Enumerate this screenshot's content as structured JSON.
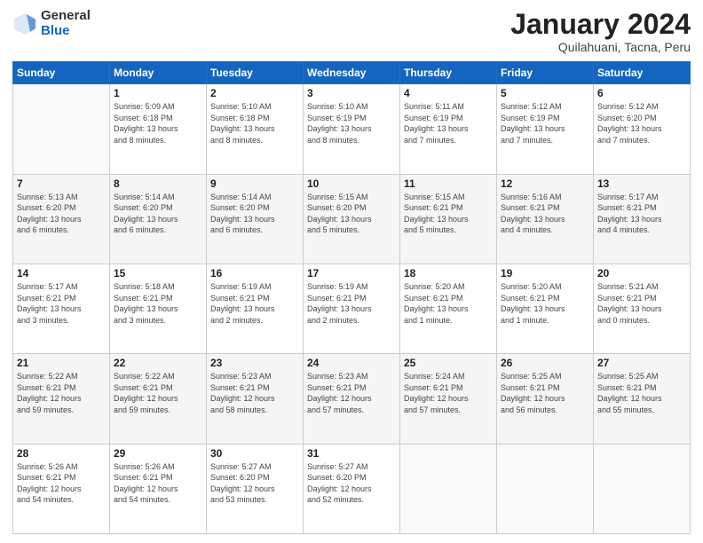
{
  "logo": {
    "general": "General",
    "blue": "Blue"
  },
  "header": {
    "title": "January 2024",
    "subtitle": "Quilahuani, Tacna, Peru"
  },
  "days_of_week": [
    "Sunday",
    "Monday",
    "Tuesday",
    "Wednesday",
    "Thursday",
    "Friday",
    "Saturday"
  ],
  "weeks": [
    [
      {
        "day": "",
        "info": ""
      },
      {
        "day": "1",
        "info": "Sunrise: 5:09 AM\nSunset: 6:18 PM\nDaylight: 13 hours\nand 8 minutes."
      },
      {
        "day": "2",
        "info": "Sunrise: 5:10 AM\nSunset: 6:18 PM\nDaylight: 13 hours\nand 8 minutes."
      },
      {
        "day": "3",
        "info": "Sunrise: 5:10 AM\nSunset: 6:19 PM\nDaylight: 13 hours\nand 8 minutes."
      },
      {
        "day": "4",
        "info": "Sunrise: 5:11 AM\nSunset: 6:19 PM\nDaylight: 13 hours\nand 7 minutes."
      },
      {
        "day": "5",
        "info": "Sunrise: 5:12 AM\nSunset: 6:19 PM\nDaylight: 13 hours\nand 7 minutes."
      },
      {
        "day": "6",
        "info": "Sunrise: 5:12 AM\nSunset: 6:20 PM\nDaylight: 13 hours\nand 7 minutes."
      }
    ],
    [
      {
        "day": "7",
        "info": "Sunrise: 5:13 AM\nSunset: 6:20 PM\nDaylight: 13 hours\nand 6 minutes."
      },
      {
        "day": "8",
        "info": "Sunrise: 5:14 AM\nSunset: 6:20 PM\nDaylight: 13 hours\nand 6 minutes."
      },
      {
        "day": "9",
        "info": "Sunrise: 5:14 AM\nSunset: 6:20 PM\nDaylight: 13 hours\nand 6 minutes."
      },
      {
        "day": "10",
        "info": "Sunrise: 5:15 AM\nSunset: 6:20 PM\nDaylight: 13 hours\nand 5 minutes."
      },
      {
        "day": "11",
        "info": "Sunrise: 5:15 AM\nSunset: 6:21 PM\nDaylight: 13 hours\nand 5 minutes."
      },
      {
        "day": "12",
        "info": "Sunrise: 5:16 AM\nSunset: 6:21 PM\nDaylight: 13 hours\nand 4 minutes."
      },
      {
        "day": "13",
        "info": "Sunrise: 5:17 AM\nSunset: 6:21 PM\nDaylight: 13 hours\nand 4 minutes."
      }
    ],
    [
      {
        "day": "14",
        "info": "Sunrise: 5:17 AM\nSunset: 6:21 PM\nDaylight: 13 hours\nand 3 minutes."
      },
      {
        "day": "15",
        "info": "Sunrise: 5:18 AM\nSunset: 6:21 PM\nDaylight: 13 hours\nand 3 minutes."
      },
      {
        "day": "16",
        "info": "Sunrise: 5:19 AM\nSunset: 6:21 PM\nDaylight: 13 hours\nand 2 minutes."
      },
      {
        "day": "17",
        "info": "Sunrise: 5:19 AM\nSunset: 6:21 PM\nDaylight: 13 hours\nand 2 minutes."
      },
      {
        "day": "18",
        "info": "Sunrise: 5:20 AM\nSunset: 6:21 PM\nDaylight: 13 hours\nand 1 minute."
      },
      {
        "day": "19",
        "info": "Sunrise: 5:20 AM\nSunset: 6:21 PM\nDaylight: 13 hours\nand 1 minute."
      },
      {
        "day": "20",
        "info": "Sunrise: 5:21 AM\nSunset: 6:21 PM\nDaylight: 13 hours\nand 0 minutes."
      }
    ],
    [
      {
        "day": "21",
        "info": "Sunrise: 5:22 AM\nSunset: 6:21 PM\nDaylight: 12 hours\nand 59 minutes."
      },
      {
        "day": "22",
        "info": "Sunrise: 5:22 AM\nSunset: 6:21 PM\nDaylight: 12 hours\nand 59 minutes."
      },
      {
        "day": "23",
        "info": "Sunrise: 5:23 AM\nSunset: 6:21 PM\nDaylight: 12 hours\nand 58 minutes."
      },
      {
        "day": "24",
        "info": "Sunrise: 5:23 AM\nSunset: 6:21 PM\nDaylight: 12 hours\nand 57 minutes."
      },
      {
        "day": "25",
        "info": "Sunrise: 5:24 AM\nSunset: 6:21 PM\nDaylight: 12 hours\nand 57 minutes."
      },
      {
        "day": "26",
        "info": "Sunrise: 5:25 AM\nSunset: 6:21 PM\nDaylight: 12 hours\nand 56 minutes."
      },
      {
        "day": "27",
        "info": "Sunrise: 5:25 AM\nSunset: 6:21 PM\nDaylight: 12 hours\nand 55 minutes."
      }
    ],
    [
      {
        "day": "28",
        "info": "Sunrise: 5:26 AM\nSunset: 6:21 PM\nDaylight: 12 hours\nand 54 minutes."
      },
      {
        "day": "29",
        "info": "Sunrise: 5:26 AM\nSunset: 6:21 PM\nDaylight: 12 hours\nand 54 minutes."
      },
      {
        "day": "30",
        "info": "Sunrise: 5:27 AM\nSunset: 6:20 PM\nDaylight: 12 hours\nand 53 minutes."
      },
      {
        "day": "31",
        "info": "Sunrise: 5:27 AM\nSunset: 6:20 PM\nDaylight: 12 hours\nand 52 minutes."
      },
      {
        "day": "",
        "info": ""
      },
      {
        "day": "",
        "info": ""
      },
      {
        "day": "",
        "info": ""
      }
    ]
  ]
}
